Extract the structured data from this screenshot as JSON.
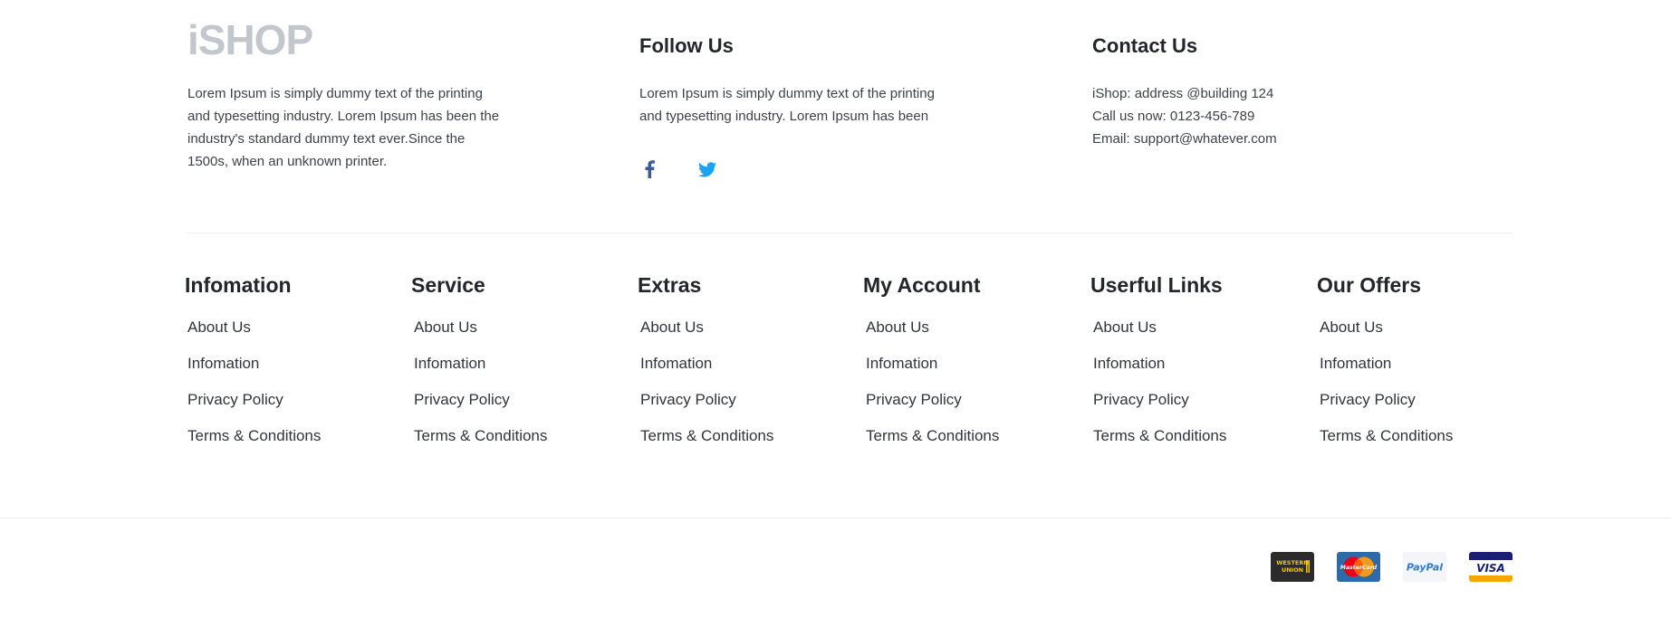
{
  "brand": {
    "logo_text": "iSHOP",
    "description": "Lorem Ipsum is simply dummy text of the printing and typesetting industry. Lorem Ipsum has been the industry's standard dummy text ever.Since the 1500s, when an unknown printer."
  },
  "follow": {
    "title": "Follow Us",
    "description": "Lorem Ipsum is simply dummy text of the printing and typesetting industry. Lorem Ipsum has been",
    "icons": [
      "facebook-icon",
      "twitter-icon"
    ]
  },
  "contact": {
    "title": "Contact Us",
    "address": "iShop: address @building 124",
    "phone": "Call us now: 0123-456-789",
    "email": "Email: support@whatever.com"
  },
  "link_columns": [
    {
      "title": "Infomation",
      "links": [
        "About Us",
        "Infomation",
        "Privacy Policy",
        "Terms & Conditions"
      ]
    },
    {
      "title": "Service",
      "links": [
        "About Us",
        "Infomation",
        "Privacy Policy",
        "Terms & Conditions"
      ]
    },
    {
      "title": "Extras",
      "links": [
        "About Us",
        "Infomation",
        "Privacy Policy",
        "Terms & Conditions"
      ]
    },
    {
      "title": "My Account",
      "links": [
        "About Us",
        "Infomation",
        "Privacy Policy",
        "Terms & Conditions"
      ]
    },
    {
      "title": "Userful Links",
      "links": [
        "About Us",
        "Infomation",
        "Privacy Policy",
        "Terms & Conditions"
      ]
    },
    {
      "title": "Our Offers",
      "links": [
        "About Us",
        "Infomation",
        "Privacy Policy",
        "Terms & Conditions"
      ]
    }
  ],
  "payments": {
    "western_union_line1": "WESTERN",
    "western_union_line2": "UNION",
    "mastercard": "MasterCard",
    "paypal": "PayPal",
    "visa": "VISA"
  },
  "colors": {
    "logo": "#c2c7cd",
    "heading": "#22262a",
    "facebook": "#3b5998",
    "twitter": "#1da1f2",
    "western_union_bg": "#2b2b2b",
    "western_union_text": "#f5c518",
    "mastercard_bg": "#2f69a8",
    "visa_blue": "#1a1f71",
    "visa_gold": "#f7a600"
  }
}
